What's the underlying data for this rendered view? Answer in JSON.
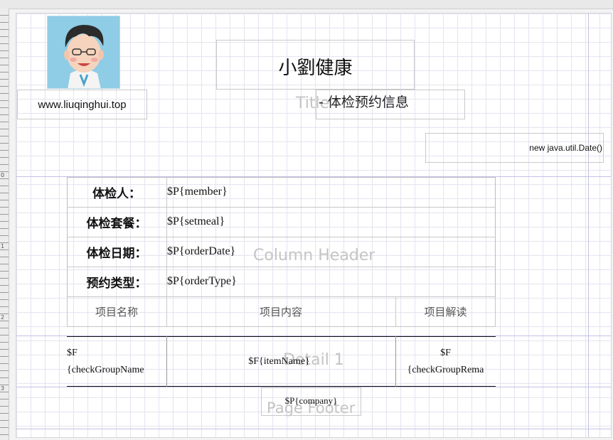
{
  "report": {
    "title": "小劉健康",
    "subtitle": "- 体检预约信息",
    "website": "www.liuqinghui.top",
    "date_expression": "new java.util.Date()",
    "info_rows": [
      {
        "label": "体检人：",
        "value": "$P{member}"
      },
      {
        "label": "体检套餐：",
        "value": "$P{setmeal}"
      },
      {
        "label": "体检日期：",
        "value": "$P{orderDate}"
      },
      {
        "label": "预约类型：",
        "value": "$P{orderType}"
      }
    ],
    "columns": [
      "项目名称",
      "项目内容",
      "项目解读"
    ],
    "detail": {
      "name_field": "$F\n{checkGroupName",
      "content_field": "$F{itemName}",
      "remark_field": "$F\n{checkGroupRema"
    },
    "footer_field": "$P{company}"
  },
  "bands": {
    "title": "Title",
    "column_header": "Column Header",
    "detail": "Detail 1",
    "page_footer": "Page Footer"
  },
  "ruler": {
    "marks": [
      "0",
      "1",
      "2",
      "3"
    ]
  },
  "avatar": {
    "icon": "cartoon-avatar-icon",
    "bg": "#8fcde6"
  }
}
